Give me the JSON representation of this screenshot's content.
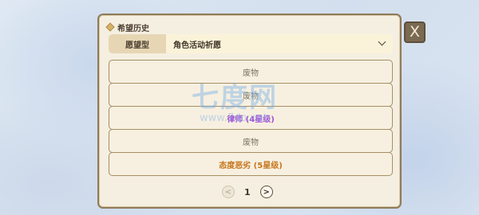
{
  "window": {
    "title": "希望历史",
    "close_label": "X"
  },
  "filter": {
    "label": "愿望型",
    "selected": "角色活动祈愿"
  },
  "results": [
    {
      "text": "废物",
      "color": "#7c7366"
    },
    {
      "text": "废物",
      "color": "#7c7366"
    },
    {
      "text": "律师 (4星级)",
      "color": "#a155d6"
    },
    {
      "text": "废物",
      "color": "#7c7366"
    },
    {
      "text": "态度恶劣 (5星级)",
      "color": "#c7761f"
    }
  ],
  "pagination": {
    "prev": "<",
    "page": "1",
    "next": ">"
  },
  "watermark": {
    "big": "七度网",
    "small": "www.7do.net"
  },
  "icons": {
    "title_bullet": "diamond-icon",
    "dropdown": "chevron-down-icon"
  }
}
